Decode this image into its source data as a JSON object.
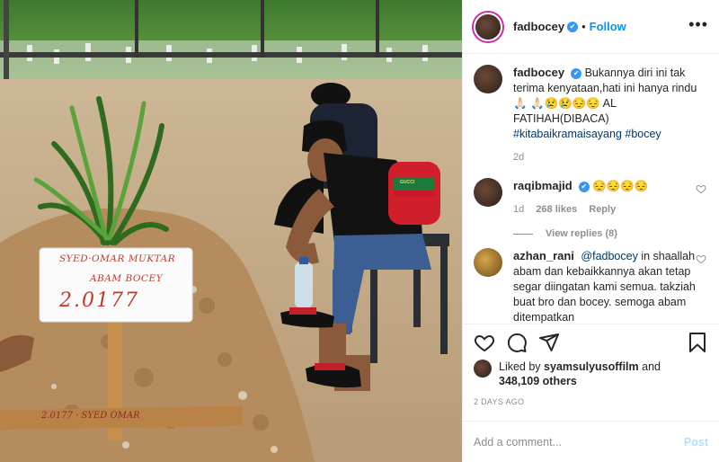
{
  "header": {
    "username": "fadbocey",
    "verified_mark": "✔",
    "separator": "•",
    "follow_label": "Follow",
    "more_label": "•••"
  },
  "photo": {
    "sign_lines": [
      "SYED·OMAR MUKTAR",
      "ABAM BOCEY",
      "2.0177"
    ],
    "plank_text": "2.0177 · SYED OMAR",
    "bag_label": "GUCCI"
  },
  "caption": {
    "username": "fadbocey",
    "text": "Bukannya diri ini tak terima kenyataan,hati ini hanya rindu 🙏🏻 🙏🏻😢😢😔😔 AL FATIHAH(DIBACA)",
    "hashtags": "#kitabaikramaisayang #bocey",
    "time": "2d"
  },
  "comments": [
    {
      "username": "raqibmajid",
      "verified": true,
      "text": "😔😔😔😔",
      "time": "1d",
      "likes": "268 likes",
      "reply": "Reply",
      "view_replies": "View replies (8)"
    },
    {
      "username": "azhan_rani",
      "verified": false,
      "mention": "@fadbocey",
      "text": "in shaallah abam dan kebaikkannya akan tetap segar diingatan kami semua. takziah buat bro dan bocey. semoga abam ditempatkan"
    }
  ],
  "actions": {
    "icons": [
      "heart-icon",
      "comment-icon",
      "share-icon",
      "bookmark-icon"
    ]
  },
  "likes": {
    "prefix": "Liked by",
    "user": "syamsulyusoffilm",
    "conj": "and",
    "count": "348,109 others"
  },
  "date": "2 DAYS AGO",
  "add_comment": {
    "placeholder": "Add a comment...",
    "post_label": "Post"
  },
  "colors": {
    "link": "#0095f6",
    "hashtag": "#00376b",
    "muted": "#8e8e8e",
    "verified": "#3897f0",
    "sign_ink": "#c0392b"
  }
}
